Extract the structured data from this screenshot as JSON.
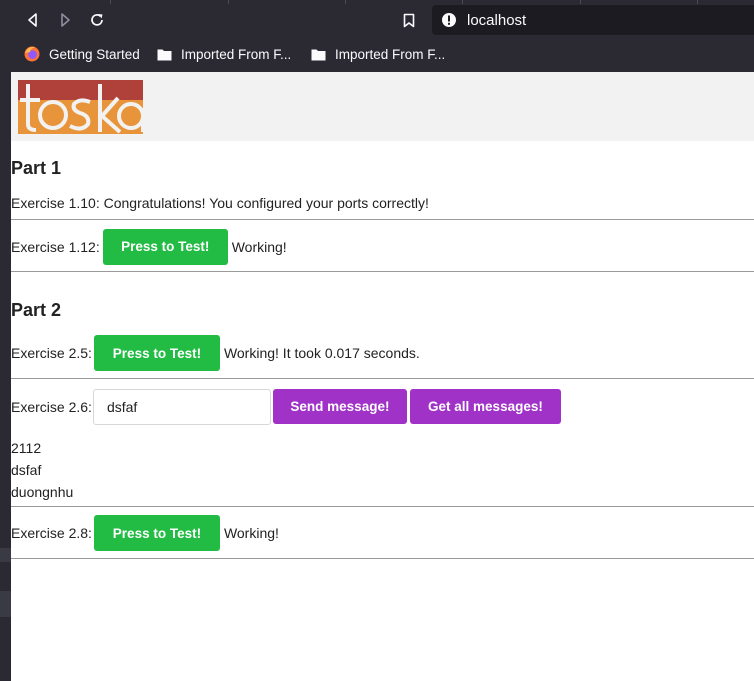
{
  "browser": {
    "url": "localhost",
    "bookmarks": [
      {
        "label": "Getting Started",
        "icon": "firefox-icon"
      },
      {
        "label": "Imported From F...",
        "icon": "folder-icon"
      },
      {
        "label": "Imported From F...",
        "icon": "folder-icon"
      }
    ]
  },
  "logo": {
    "alt": "toska",
    "colors": {
      "left": "#b0403a",
      "right": "#e8943a"
    }
  },
  "part1": {
    "title": "Part 1",
    "ex110": {
      "label": "Exercise 1.10: Congratulations! You configured your ports correctly!"
    },
    "ex112": {
      "label": "Exercise 1.12:",
      "button": "Press to Test!",
      "status": "Working!"
    }
  },
  "part2": {
    "title": "Part 2",
    "ex25": {
      "label": "Exercise 2.5:",
      "button": "Press to Test!",
      "status": "Working! It took 0.017 seconds."
    },
    "ex26": {
      "label": "Exercise 2.6:",
      "input_value": "dsfaf",
      "send_button": "Send message!",
      "get_button": "Get all messages!"
    },
    "messages": [
      "2112",
      "dsfaf",
      "duongnhu"
    ],
    "ex28": {
      "label": "Exercise 2.8:",
      "button": "Press to Test!",
      "status": "Working!"
    }
  },
  "colors": {
    "green": "#22bb44",
    "purple": "#a032c8"
  }
}
